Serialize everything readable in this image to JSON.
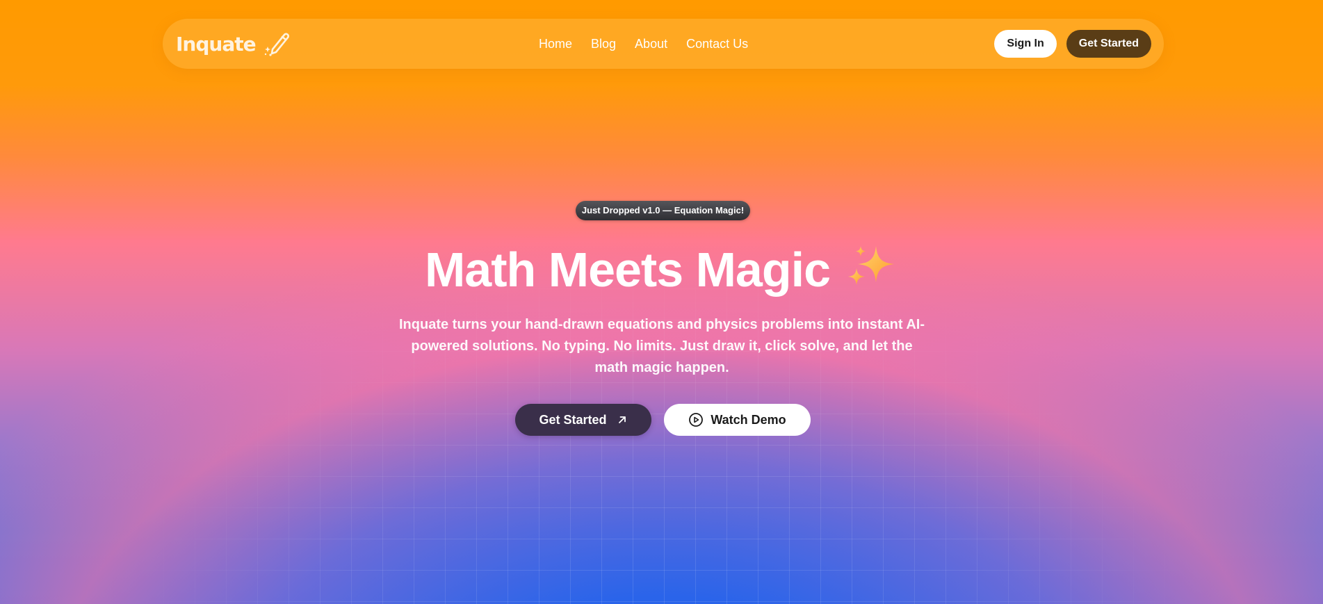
{
  "brand": {
    "name": "Inquate",
    "logo_icon": "pencil-sparkle-icon"
  },
  "nav": {
    "links": [
      {
        "label": "Home"
      },
      {
        "label": "Blog"
      },
      {
        "label": "About"
      },
      {
        "label": "Contact Us"
      }
    ],
    "sign_in_label": "Sign In",
    "get_started_label": "Get Started"
  },
  "hero": {
    "badge": "Just Dropped v1.0 — Equation Magic!",
    "headline": "Math Meets Magic",
    "headline_icon": "sparkles-icon",
    "subtitle": "Inquate turns your hand-drawn equations and physics problems into instant AI-powered solutions. No typing. No limits. Just draw it, click solve, and let the math magic happen.",
    "primary_cta": {
      "label": "Get Started",
      "icon": "arrow-up-right-icon"
    },
    "secondary_cta": {
      "label": "Watch Demo",
      "icon": "play-circle-icon"
    }
  },
  "colors": {
    "top": "#ff9a00",
    "middle": "#ff7a8e",
    "bottom": "#2563eb",
    "nav_cta": "#5a3d16",
    "hero_cta": "#3a2f4a"
  }
}
